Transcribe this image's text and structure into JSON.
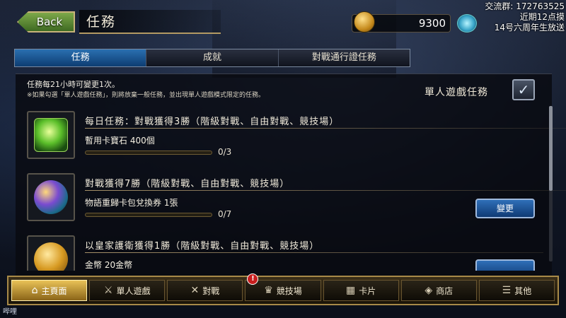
{
  "header": {
    "back_label": "Back",
    "page_title": "任務",
    "coins": "9300"
  },
  "overlay": {
    "line1": "交流群: 172763525",
    "line2": "近期12点摸",
    "line3": "14号六周年生放送"
  },
  "tabs": [
    {
      "label": "任務",
      "active": true
    },
    {
      "label": "成就",
      "active": false
    },
    {
      "label": "對戰通行證任務",
      "active": false
    }
  ],
  "notes": {
    "line1": "任務每21小時可變更1次。",
    "line2": "※如果勾選「單人遊戲任務」，則將放棄一般任務，並出現單人遊戲模式限定的任務。"
  },
  "solo": {
    "label": "單人遊戲任務",
    "checked": true,
    "check_glyph": "✓"
  },
  "missions": [
    {
      "title": "每日任務：對戰獲得3勝（階級對戰、自由對戰、競技場）",
      "reward": "暫用卡寶石 400個",
      "progress": "0/3",
      "progress_fraction": 0,
      "icon": "green-gem-icon"
    },
    {
      "title": "對戰獲得7勝（階級對戰、自由對戰、競技場）",
      "reward": "物語重歸卡包兌換券 1張",
      "progress": "0/7",
      "progress_fraction": 0,
      "icon": "orb-ticket-icon",
      "change_label": "變更"
    },
    {
      "title": "以皇家護衛獲得1勝（階級對戰、自由對戰、競技場）",
      "reward": "金幣 20金幣",
      "icon": "gold-coins-icon"
    }
  ],
  "nav": [
    {
      "label": "主頁面",
      "icon": "home-icon",
      "active": true
    },
    {
      "label": "單人遊戲",
      "icon": "solo-sword-icon"
    },
    {
      "label": "對戰",
      "icon": "crossed-swords-icon"
    },
    {
      "label": "競技場",
      "icon": "arena-icon",
      "badge": "!"
    },
    {
      "label": "卡片",
      "icon": "cards-icon"
    },
    {
      "label": "商店",
      "icon": "shop-icon"
    },
    {
      "label": "其他",
      "icon": "other-icon"
    }
  ],
  "watermark": "哔哩"
}
